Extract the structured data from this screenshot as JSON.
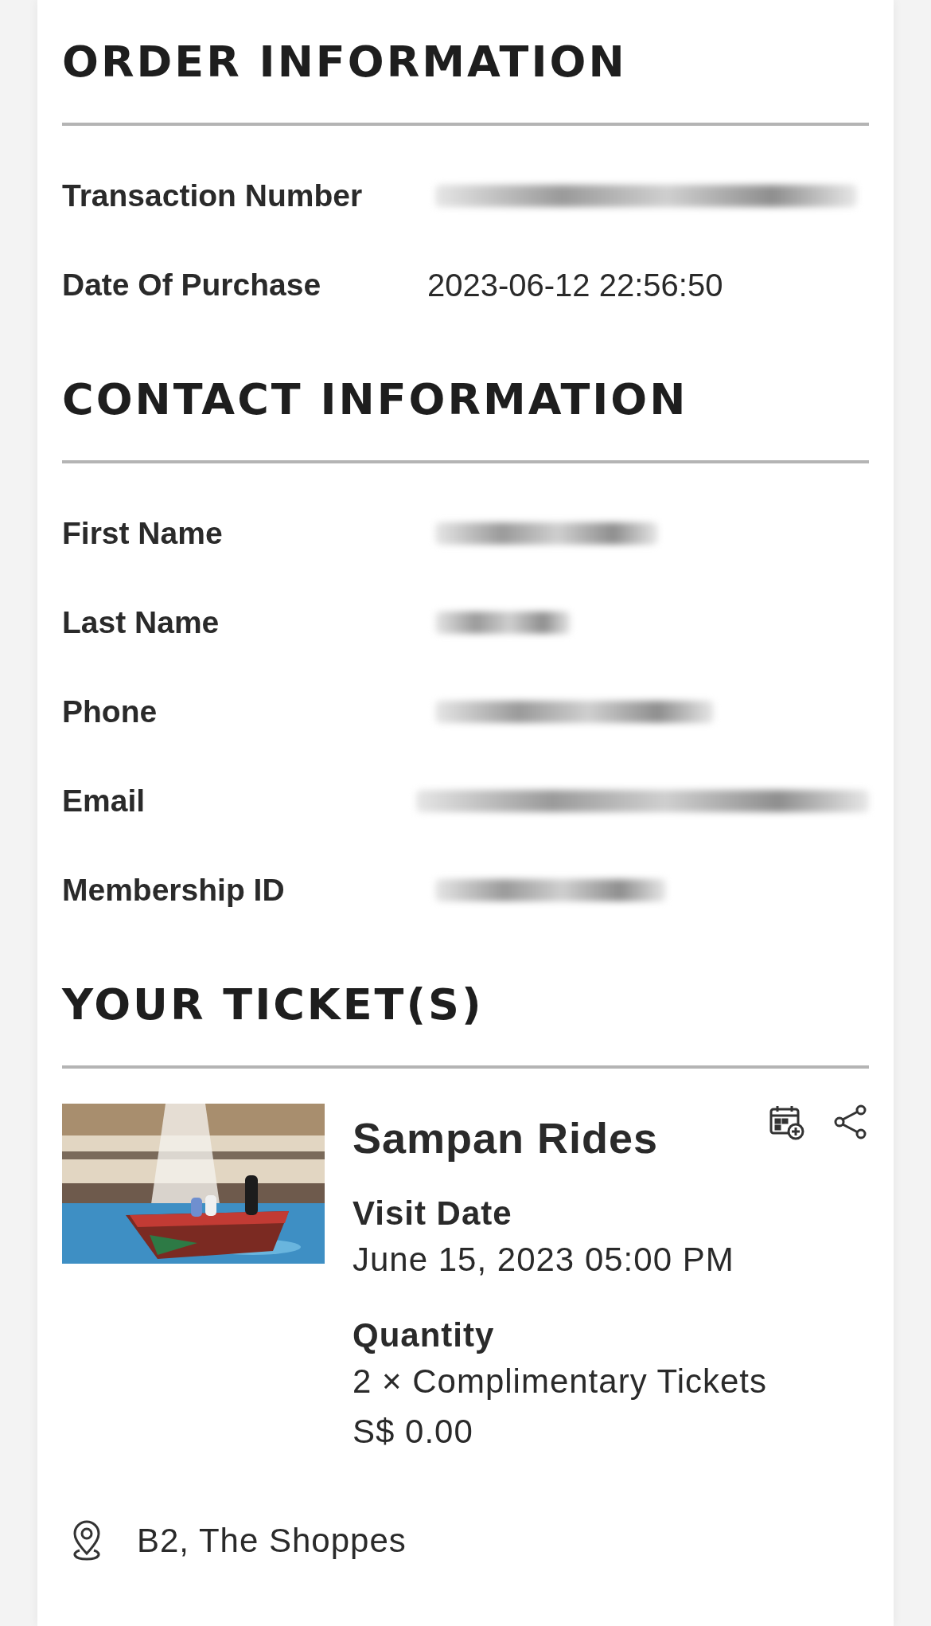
{
  "sections": [
    {
      "title": "ORDER INFORMATION",
      "rows": [
        {
          "label": "Transaction Number",
          "redacted": true
        },
        {
          "label": "Date Of Purchase",
          "redacted": false,
          "value": "2023-06-12 22:56:50"
        }
      ]
    },
    {
      "title": "CONTACT INFORMATION",
      "rows": [
        {
          "label": "First Name",
          "redacted": true
        },
        {
          "label": "Last Name",
          "redacted": true
        },
        {
          "label": "Phone",
          "redacted": true
        },
        {
          "label": "Email",
          "redacted": true
        },
        {
          "label": "Membership ID",
          "redacted": true
        }
      ]
    },
    {
      "title": "YOUR TICKET(S)"
    }
  ],
  "ticket": {
    "name": "Sampan Rides",
    "details": [
      {
        "label": "Visit Date",
        "lines": [
          "June 15, 2023 05:00 PM"
        ]
      },
      {
        "label": "Quantity",
        "lines": [
          "2 × Complimentary Tickets",
          "S$ 0.00"
        ]
      }
    ],
    "location": "B2, The Shoppes"
  }
}
